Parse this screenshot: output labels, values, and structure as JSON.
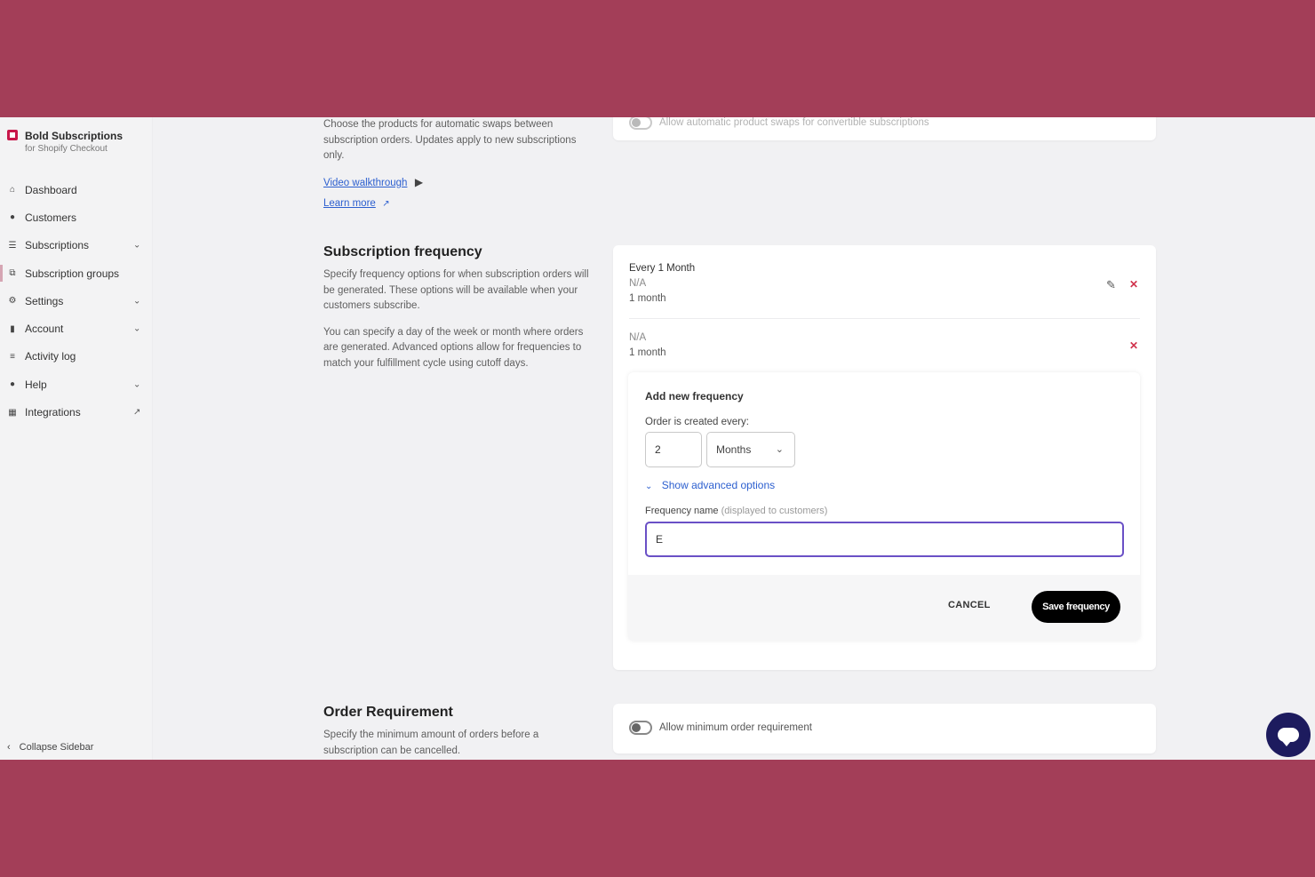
{
  "brand": {
    "name": "Bold Subscriptions",
    "subtitle": "for Shopify Checkout"
  },
  "sidebar": {
    "items": [
      {
        "label": "Dashboard"
      },
      {
        "label": "Customers"
      },
      {
        "label": "Subscriptions"
      },
      {
        "label": "Subscription groups"
      },
      {
        "label": "Settings"
      },
      {
        "label": "Account"
      },
      {
        "label": "Activity log"
      },
      {
        "label": "Help"
      },
      {
        "label": "Integrations"
      }
    ],
    "collapse_label": "Collapse Sidebar"
  },
  "product_swaps": {
    "description": "Choose the products for automatic swaps between subscription orders. Updates apply to new subscriptions only.",
    "video_link": "Video walkthrough",
    "learn_more": "Learn more",
    "toggle_label": "Allow automatic product swaps for convertible subscriptions"
  },
  "subscription_frequency": {
    "title": "Subscription frequency",
    "description_1": "Specify frequency options for when subscription orders will be generated. These options will be available when your customers subscribe.",
    "description_2": "You can specify a day of the week or month where orders are generated. Advanced options allow for frequencies to match your fulfillment cycle using cutoff days.",
    "frequencies": [
      {
        "name": "Every 1 Month",
        "cutoff": "N/A",
        "interval": "1 month"
      },
      {
        "name": "",
        "cutoff": "N/A",
        "interval": "1 month"
      }
    ],
    "add_form": {
      "title": "Add new frequency",
      "order_label": "Order is created every:",
      "interval_value": "2",
      "interval_unit": "Months",
      "advanced_toggle": "Show advanced options",
      "name_label": "Frequency name",
      "name_hint": "(displayed to customers)",
      "name_value": "E",
      "cancel_label": "CANCEL",
      "save_label": "Save frequency"
    }
  },
  "order_requirement": {
    "title": "Order Requirement",
    "description": "Specify the minimum amount of orders before a subscription can be cancelled.",
    "toggle_label": "Allow minimum order requirement"
  },
  "colors": {
    "brand": "#c8174a",
    "frame": "#a33e58",
    "link": "#2c5fcf",
    "focus": "#6a50c6",
    "chat": "#1d1b5e"
  }
}
